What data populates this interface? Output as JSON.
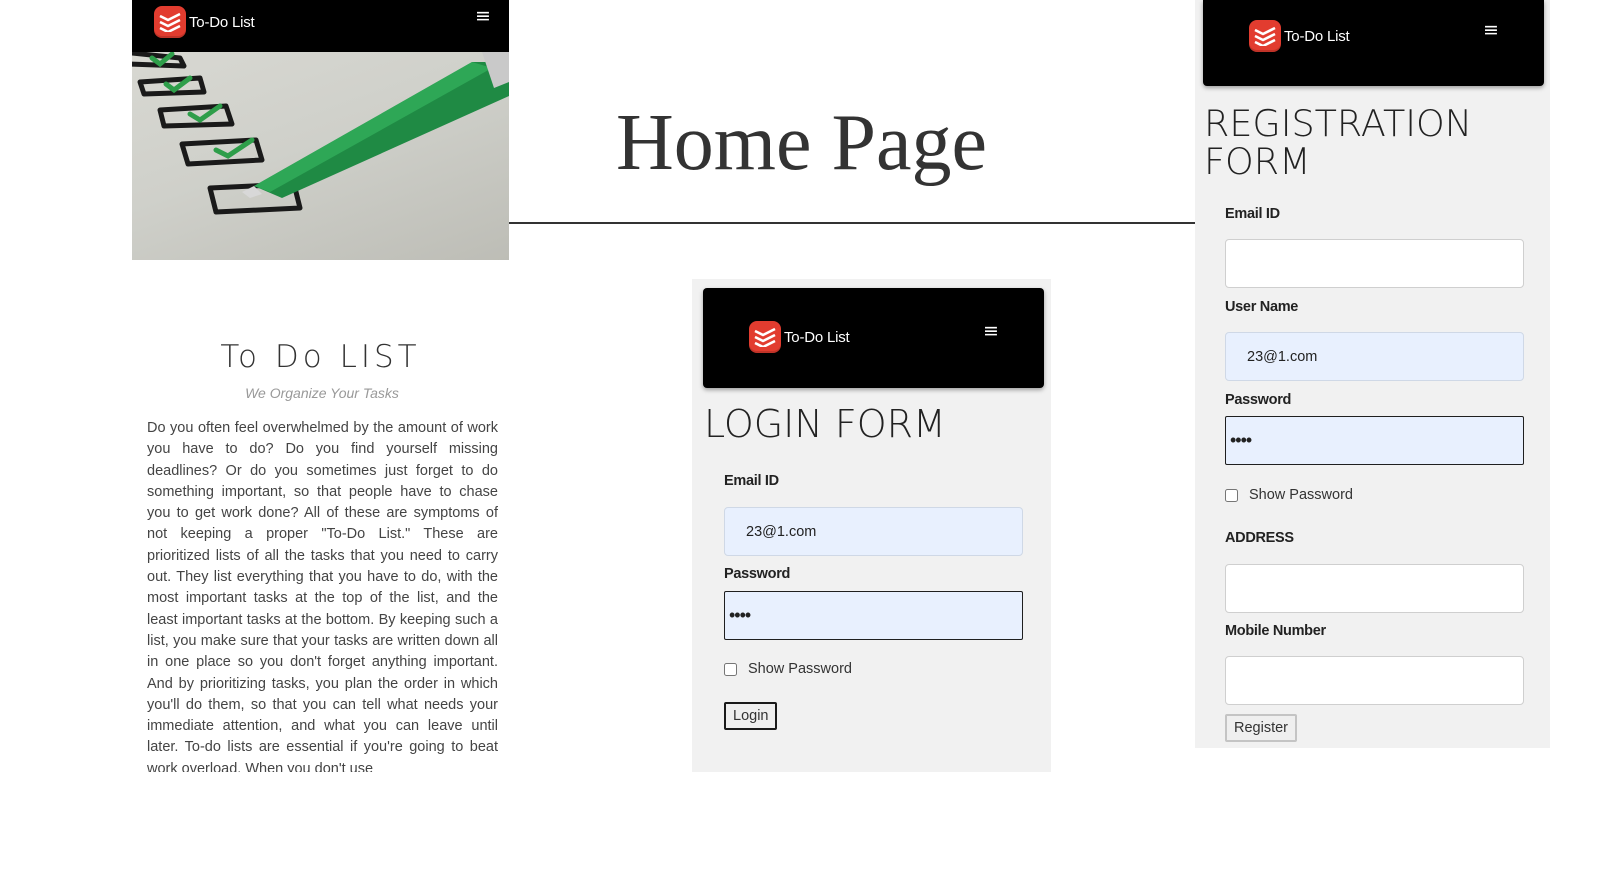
{
  "brand": {
    "name": "To-Do List",
    "logo_icon": "todoist-stack-icon",
    "logo_color": "#e23c2f",
    "menu_icon": "≡"
  },
  "headline": "Home Page",
  "home": {
    "hero_image": "checklist-pen-image",
    "title": "To Do LIST",
    "tagline": "We Organize Your Tasks",
    "body": "Do you often feel overwhelmed by the amount of work you have to do? Do you find yourself missing deadlines? Or do you sometimes just forget to do something important, so that people have to chase you to get work done? All of these are symptoms of not keeping a proper \"To-Do List.\" These are prioritized lists of all the tasks that you need to carry out. They list everything that you have to do, with the most important tasks at the top of the list, and the least important tasks at the bottom. By keeping such a list, you make sure that your tasks are written down all in one place so you don't forget anything important. And by prioritizing tasks, you plan the order in which you'll do them, so that you can tell what needs your immediate attention, and what you can leave until later. To-do lists are essential if you're going to beat work overload. When you don't use"
  },
  "login": {
    "title": "LOGIN FORM",
    "email_label": "Email ID",
    "email_value": "23@1.com",
    "password_label": "Password",
    "password_value": "••••",
    "show_password": "Show Password",
    "button": "Login"
  },
  "register": {
    "title": "REGISTRATION FORM",
    "email_label": "Email ID",
    "email_value": "",
    "username_label": "User Name",
    "username_value": "23@1.com",
    "password_label": "Password",
    "password_value": "••••",
    "show_password": "Show Password",
    "address_label": "ADDRESS",
    "address_value": "",
    "mobile_label": "Mobile Number",
    "mobile_value": "",
    "button": "Register"
  }
}
